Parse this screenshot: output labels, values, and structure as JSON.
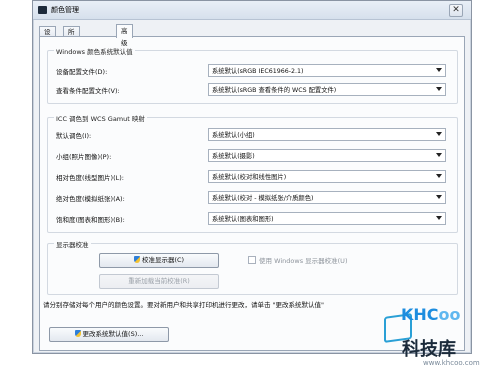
{
  "window": {
    "title": "颜色管理",
    "close_glyph": "✕"
  },
  "tabs": [
    {
      "label": "设备"
    },
    {
      "label": "所有配置文件"
    },
    {
      "label": "高级",
      "active": true
    }
  ],
  "windows_defaults": {
    "group_title": "Windows 颜色系统默认值",
    "device_profile_label": "设备配置文件(D):",
    "device_profile_value": "系统默认(sRGB IEC61966-2.1)",
    "viewing_profile_label": "查看条件配置文件(V):",
    "viewing_profile_value": "系统默认(sRGB 查看条件的 WCS 配置文件)"
  },
  "icc_mapping": {
    "group_title": "ICC 调色到 WCS Gamut 映射",
    "rows": [
      {
        "label": "默认调色(I):",
        "value": "系统默认(小组)"
      },
      {
        "label": "小组(照片图像)(P):",
        "value": "系统默认(摄影)"
      },
      {
        "label": "相对色度(线型图片)(L):",
        "value": "系统默认(校对和线性图片)"
      },
      {
        "label": "绝对色度(模拟纸张)(A):",
        "value": "系统默认(校对 - 模拟纸张/介质颜色)"
      },
      {
        "label": "饱和度(图表和图形)(B):",
        "value": "系统默认(图表和图形)"
      }
    ]
  },
  "calibration": {
    "group_title": "显示器校准",
    "calibrate_button": "校准显示器(C)",
    "reload_button": "重新加载当前校准(R)",
    "use_windows_calibration_label": "使用 Windows 显示器校准(U)"
  },
  "footer": {
    "info_text": "请分别存储对每个用户的颜色设置。要对新用户和共享打印机进行更改，请单击 \"更改系统默认值\"",
    "change_defaults_button": "更改系统默认值(S)..."
  },
  "watermark": {
    "brand_prefix": "KHC",
    "brand_suffix": "oo",
    "name": "科技库",
    "url": "www.khcoo.com"
  },
  "colors": {
    "window_bg": "#eef1f5",
    "content_bg": "#fbfcfd",
    "watermark_blue": "#1d8ddf"
  },
  "icons": {
    "app": "color-management-icon",
    "admin": "uac-shield-icon",
    "dropdown": "chevron-down-icon"
  }
}
